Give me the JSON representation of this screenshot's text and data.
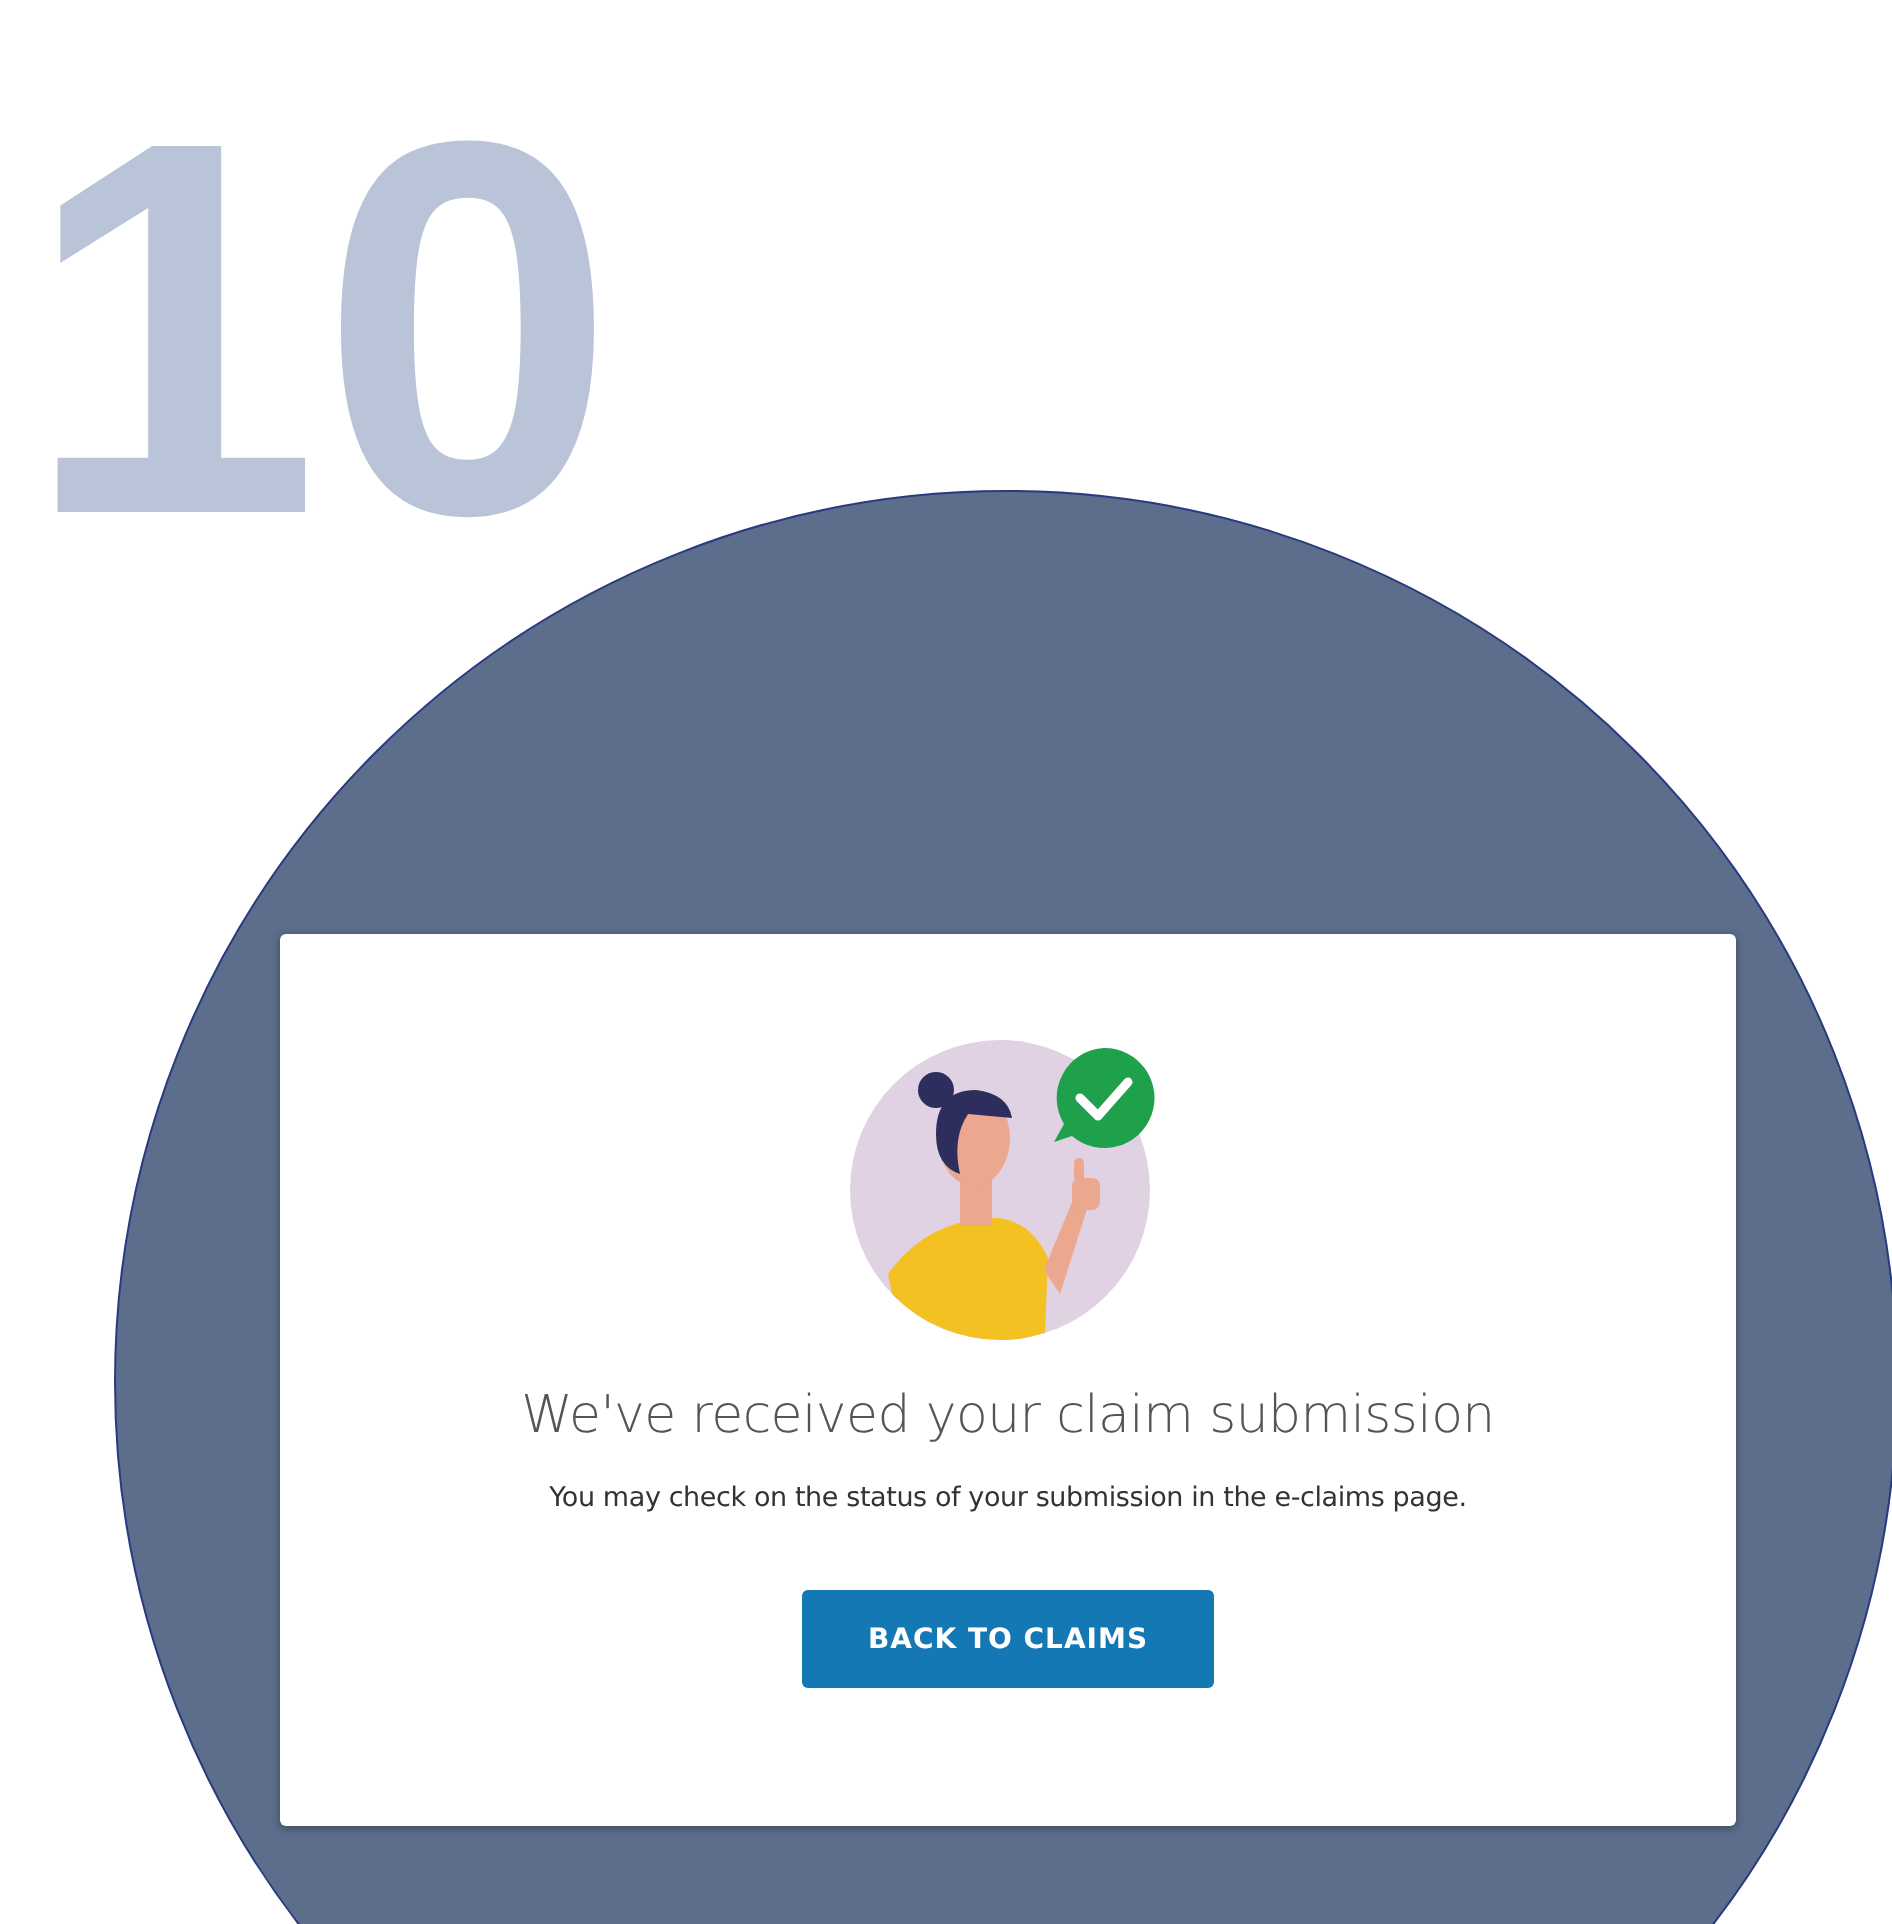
{
  "step_number": "10",
  "confirmation_card": {
    "heading": "We've received your claim submission",
    "message": "You may check on the status of your submission in the e-claims page.",
    "button": "BACK TO CLAIMS"
  }
}
